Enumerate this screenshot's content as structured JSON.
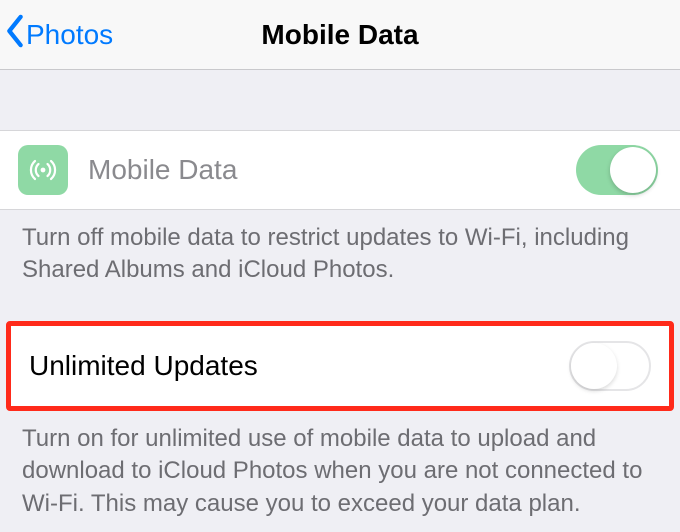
{
  "nav": {
    "back_label": "Photos",
    "title": "Mobile Data"
  },
  "rows": {
    "mobile_data": {
      "label": "Mobile Data",
      "enabled": true,
      "footer": "Turn off mobile data to restrict updates to Wi-Fi, including Shared Albums and iCloud Photos."
    },
    "unlimited_updates": {
      "label": "Unlimited Updates",
      "enabled": false,
      "footer": "Turn on for unlimited use of mobile data to upload and download to iCloud Photos when you are not connected to Wi-Fi. This may cause you to exceed your data plan."
    }
  }
}
